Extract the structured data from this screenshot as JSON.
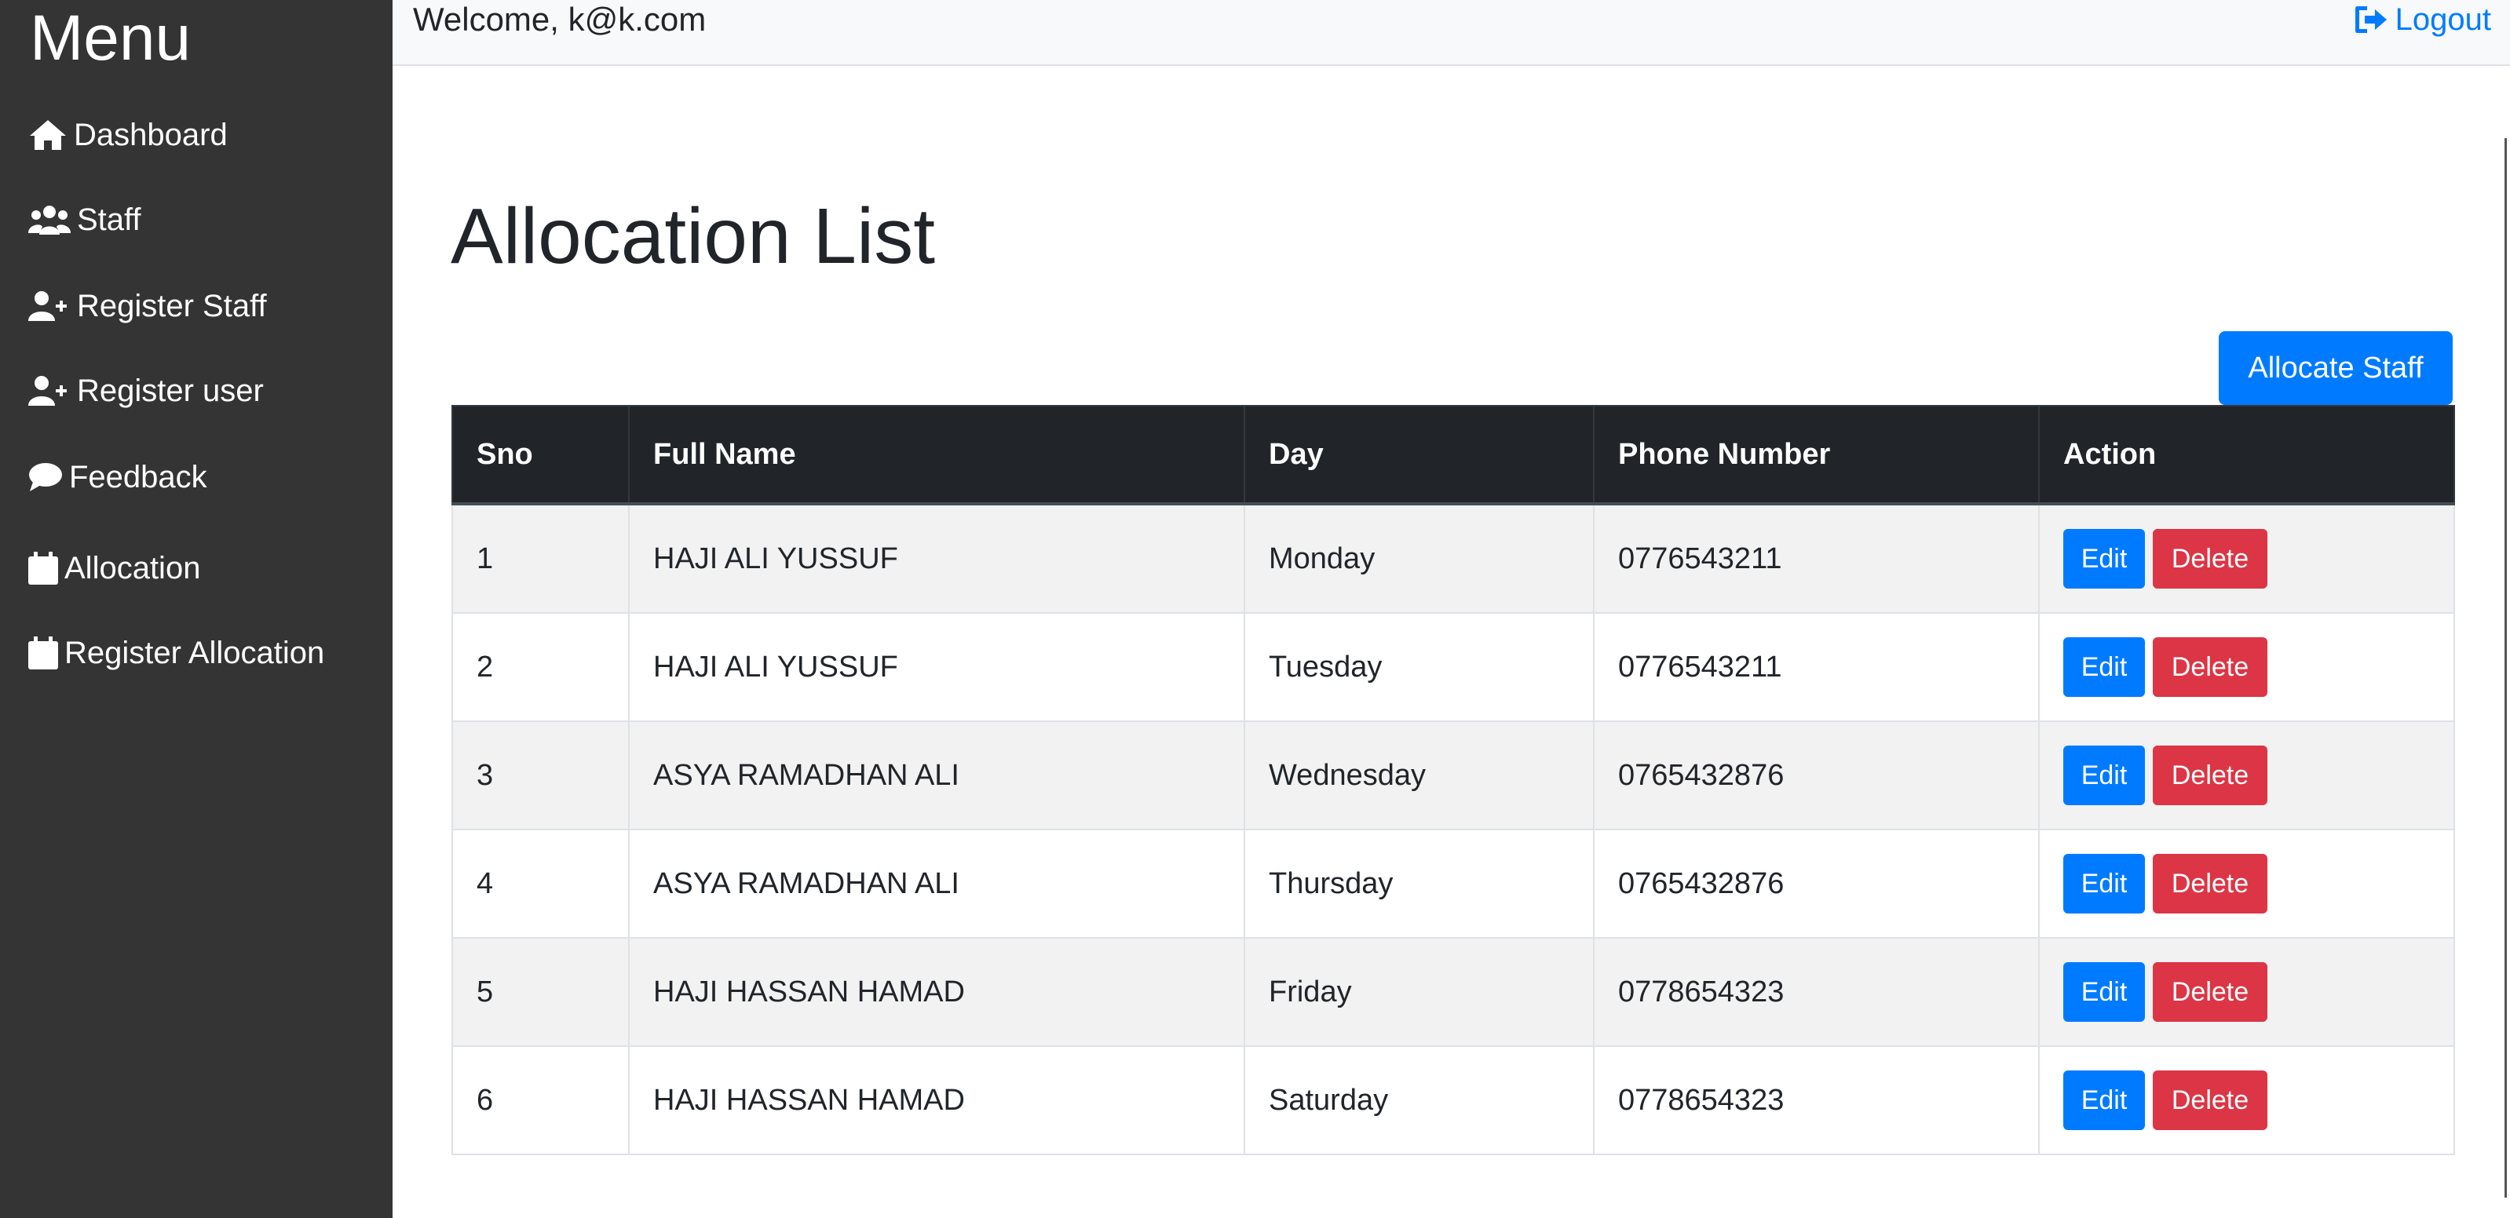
{
  "sidebar": {
    "title": "Menu",
    "items": [
      {
        "label": "Dashboard",
        "icon": "home-icon"
      },
      {
        "label": "Staff",
        "icon": "users-icon"
      },
      {
        "label": "Register Staff",
        "icon": "user-plus-icon"
      },
      {
        "label": "Register user",
        "icon": "user-plus-icon"
      },
      {
        "label": "Feedback",
        "icon": "comment-icon"
      },
      {
        "label": "Allocation",
        "icon": "calendar-icon"
      },
      {
        "label": "Register Allocation",
        "icon": "calendar-icon"
      }
    ]
  },
  "topbar": {
    "welcome": "Welcome, k@k.com",
    "logout_label": "Logout"
  },
  "main": {
    "title": "Allocation List",
    "allocate_label": "Allocate Staff"
  },
  "table": {
    "headers": [
      "Sno",
      "Full Name",
      "Day",
      "Phone Number",
      "Action"
    ],
    "rows": [
      {
        "sno": "1",
        "name": "HAJI ALI YUSSUF",
        "day": "Monday",
        "phone": "0776543211"
      },
      {
        "sno": "2",
        "name": "HAJI ALI YUSSUF",
        "day": "Tuesday",
        "phone": "0776543211"
      },
      {
        "sno": "3",
        "name": "ASYA RAMADHAN ALI",
        "day": "Wednesday",
        "phone": "0765432876"
      },
      {
        "sno": "4",
        "name": "ASYA RAMADHAN ALI",
        "day": "Thursday",
        "phone": "0765432876"
      },
      {
        "sno": "5",
        "name": "HAJI HASSAN HAMAD",
        "day": "Friday",
        "phone": "0778654323"
      },
      {
        "sno": "6",
        "name": "HAJI HASSAN HAMAD",
        "day": "Saturday",
        "phone": "0778654323"
      }
    ],
    "edit_label": "Edit",
    "delete_label": "Delete"
  },
  "colors": {
    "sidebar_bg": "#343434",
    "primary": "#007bff",
    "danger": "#dc3545",
    "table_header_bg": "#212529",
    "stripe": "#f2f2f2"
  }
}
